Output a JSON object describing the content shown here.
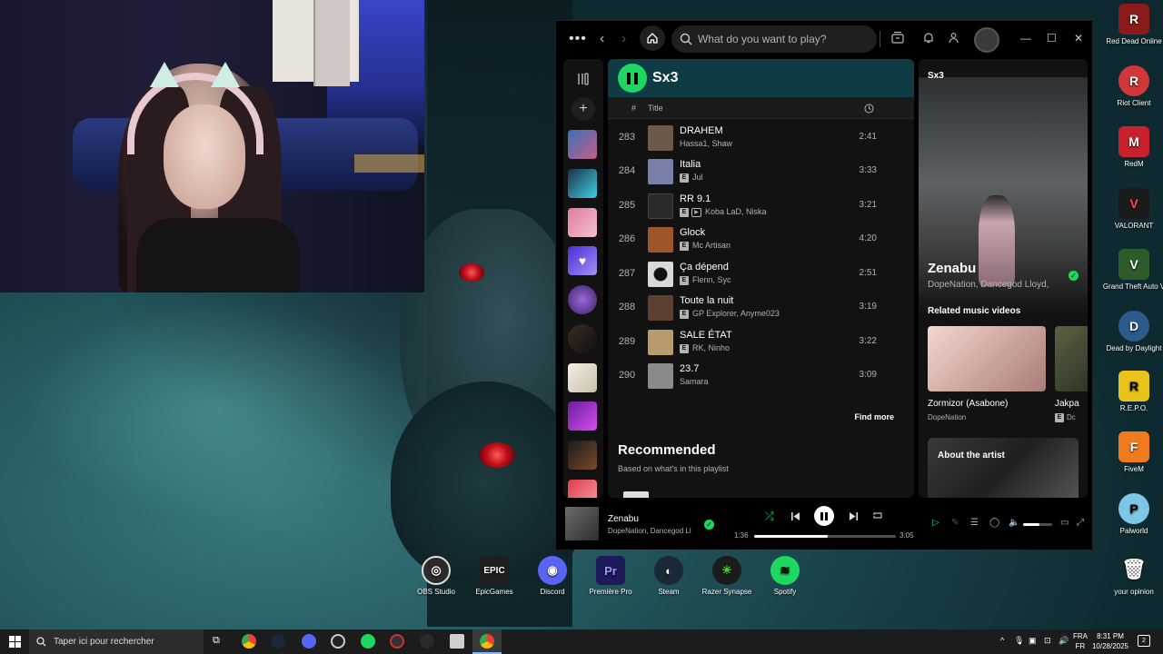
{
  "spotify": {
    "search_placeholder": "What do you want to play?",
    "playlist_title": "Sx3",
    "columns": {
      "num": "#",
      "title": "Title"
    },
    "tracks": [
      {
        "num": "283",
        "title": "DRAHEM",
        "explicit": false,
        "video": false,
        "artists": "Hassa1, Shaw",
        "duration": "2:41",
        "art": "#6b5a4a"
      },
      {
        "num": "284",
        "title": "Italia",
        "explicit": true,
        "video": false,
        "artists": "Jul",
        "duration": "3:33",
        "art": "#7a7fa8"
      },
      {
        "num": "285",
        "title": "RR 9.1",
        "explicit": true,
        "video": true,
        "artists": "Koba LaD, Niska",
        "duration": "3:21",
        "art": "#2a2a2a"
      },
      {
        "num": "286",
        "title": "Glock",
        "explicit": true,
        "video": false,
        "artists": "Mc Artisan",
        "duration": "4:20",
        "art": "#a0562b"
      },
      {
        "num": "287",
        "title": "Ça dépend",
        "explicit": true,
        "video": false,
        "artists": "Flenn, Syc",
        "duration": "2:51",
        "art": "#d9d9d9"
      },
      {
        "num": "288",
        "title": "Toute la nuit",
        "explicit": true,
        "video": false,
        "artists": "GP Explorer, Anyme023",
        "duration": "3:19",
        "art": "#5a4030"
      },
      {
        "num": "289",
        "title": "SALE ÉTAT",
        "explicit": true,
        "video": false,
        "artists": "RK, Ninho",
        "duration": "3:22",
        "art": "#b79a6e"
      },
      {
        "num": "290",
        "title": "23.7",
        "explicit": false,
        "video": false,
        "artists": "Samara",
        "duration": "3:09",
        "art": "#8a8a8a"
      }
    ],
    "explicit_badge": "E",
    "video_badge": "▶",
    "find_more": "Find more",
    "recommended_title": "Recommended",
    "recommended_sub": "Based on what's in this playlist",
    "now_playing": {
      "panel_title": "Sx3",
      "song": "Zenabu",
      "artists_full": "DopeNation, Dancegod Lloyd,",
      "artists_short": "DopeNation, Dancegod Ll",
      "related_title": "Related music videos",
      "videos": [
        {
          "title": "Zormizor (Asabone)",
          "artist": "DopeNation"
        },
        {
          "title": "Jakpa",
          "artist": "Dc"
        }
      ],
      "about_title": "About the artist"
    },
    "player": {
      "elapsed": "1:36",
      "total": "3:05",
      "progress": 0.52,
      "volume": 0.55
    }
  },
  "desktop_icons": [
    {
      "label": "Red Dead Online",
      "color": "#8b1a1a",
      "glyph": "R"
    },
    {
      "label": "Riot Client",
      "color": "#d13639",
      "glyph": "R"
    },
    {
      "label": "RedM",
      "color": "#c8232c",
      "glyph": "M"
    },
    {
      "label": "VALORANT",
      "color": "#1b1b1b",
      "glyph": "V"
    },
    {
      "label": "Grand Theft Auto V",
      "color": "#2d5c2a",
      "glyph": "V"
    },
    {
      "label": "Dead by Daylight",
      "color": "#2a5b8c",
      "glyph": "D"
    },
    {
      "label": "R.E.P.O.",
      "color": "#e8c31c",
      "glyph": "R"
    },
    {
      "label": "FiveM",
      "color": "#f07b1f",
      "glyph": "F"
    },
    {
      "label": "Palworld",
      "color": "#7dc6e6",
      "glyph": "P"
    },
    {
      "label": "your opinion",
      "color": "#d8d8d8",
      "glyph": "🗑"
    }
  ],
  "dock_icons": [
    {
      "label": "OBS Studio",
      "color": "#2b2b2b",
      "glyph": "◎"
    },
    {
      "label": "EpicGames",
      "color": "#1e1e1e",
      "glyph": "EPIC"
    },
    {
      "label": "Discord",
      "color": "#5865f2",
      "glyph": "◉"
    },
    {
      "label": "Première Pro",
      "color": "#1e1a5c",
      "glyph": "Pr"
    },
    {
      "label": "Steam",
      "color": "#1b2838",
      "glyph": "◐"
    },
    {
      "label": "Razer Synapse",
      "color": "#1b1b1b",
      "glyph": "✳"
    },
    {
      "label": "Spotify",
      "color": "#1ed760",
      "glyph": "≋"
    }
  ],
  "taskbar": {
    "search_placeholder": "Taper ici pour rechercher",
    "lang_top": "FRA",
    "lang_bottom": "FR",
    "time": "8:31 PM",
    "date": "10/28/2025",
    "notif_count": "2"
  }
}
